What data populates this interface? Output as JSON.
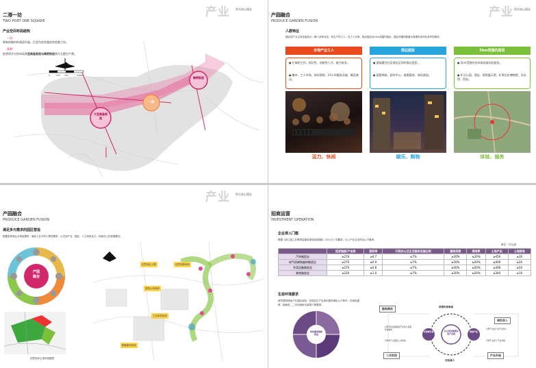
{
  "header_brand": "产业",
  "header_sub": "四大核心理念",
  "p1": {
    "title": "二港一坊",
    "title_en": "TWO PORT ONE SQUARE",
    "section": "产业空间布局结构",
    "item1_head": "一坊：",
    "item1_text": "原有的棚村的改造升级，打造为综合服务的首要工坊。",
    "item2_head": "两港：",
    "item2_text_a": "依然同步分别布局",
    "item2_text_b": "大型装备制造与精密制造",
    "item2_text_c": "两大主题生产港。",
    "scale_0": "0",
    "scale_250": "250",
    "scale_500": "500",
    "scale_1000": "1000m",
    "node_big": "大型装备制造",
    "node_fang": "一坊",
    "node_precise": "精密制造"
  },
  "p2": {
    "title": "产园融合",
    "title_en": "PRODUCE GARDEN FUSION",
    "section": "人群特征",
    "intro": "园区将产业主体总量较大，覆人多种业态，有生产的工人，在工人日常、周边居民及5km范围内居民，园区完善的配套为其提供多样化多环的服务。",
    "cards": [
      {
        "head": "本地产业工人",
        "color": "#e8491d",
        "b1": "忙碌的工作，知识性、创新性人才，能力有关。",
        "b2": "集市、工人市场、休闲酒吧、24小时服务设施、精品商店。",
        "caption": "活力、休闲"
      },
      {
        "head": "周边居民",
        "color": "#27a4dc",
        "b1": "基础看往社区就近买到的周边居民。",
        "b2": "配套商街、超市中心、度假基地、休闲游园。",
        "caption": "娱乐、购物"
      },
      {
        "head": "5km范围内居民",
        "color": "#7bbf3a",
        "b1": "5km范围内对本休闲游玩的居民。",
        "b2": "旷达公园、酒店、规划展示馆、矿泉历史博物馆、文化馆、民俗。",
        "caption": "体验、服务"
      }
    ]
  },
  "p3": {
    "title": "产园融合",
    "title_en": "PRODUCE GARDEN FUSION",
    "section": "满足多元需求的园区营造",
    "intro": "配置多样商业业场及需求，满足工业不同人群的需求，以达到产业、园区、人之间有活力，持续向上的发展模式。",
    "ring_center_a": "产园",
    "ring_center_b": "融合",
    "map_caption": "创意地块土地利用图表",
    "label_a": "创意商业人群",
    "label_b": "创意创新地块",
    "label_c": "提质公司地块",
    "label_d": "工业研发地块",
    "label_e": "配套服务地块"
  },
  "p4": {
    "title": "招商运营",
    "title_en": "INVESTMENT OPERATION",
    "section1": "企业准入门槛",
    "intro": "根据《浙江省工业等项目建设用地控制指标（2014）》的要求，引入产业应当符合以下要求。",
    "unit": "单位：万元/亩",
    "headers": [
      "",
      "投资强度/产出效",
      "容积率",
      "行政办公及生活服务设施比例",
      "建筑系数",
      "绿地率",
      "土地产出",
      "土地税收"
    ],
    "rows": [
      [
        "汽车制造业",
        "≥270",
        "≥0.7",
        "≤7%",
        "≥30%",
        "≤20%",
        "≥450",
        "≥30"
      ],
      [
        "电气机械和器材制造业",
        "≥270",
        "≥0.9",
        "≤7%",
        "≥30%",
        "≤20%",
        "≥400",
        "≥20"
      ],
      [
        "专用设备制造业",
        "≥270",
        "≥0.8",
        "≤7%",
        "≥30%",
        "≤20%",
        "≥300",
        "≥20"
      ],
      [
        "其他制造业",
        "≥220",
        "≥1.0",
        "≤7%",
        "≥30%",
        "≤20%",
        "≥340",
        "≥10"
      ]
    ],
    "section2": "生态环境要求",
    "eco_text": "研究周构绿色产业园区经验，在相应生产区域可要求满足以下条件：在绿色建筑、能耗低、二次利用和污染物少等要求。",
    "wheel_center": "绿色建筑智能制造",
    "cycle_top": "资源利用率高",
    "cycle_center_a": "长兴绿色智能制造产业园",
    "cycle_left": "可持续开发",
    "cycle_right": "绿色产业",
    "cycle_bottom": "污染减小",
    "box_tl": "能耗降低",
    "box_tr": "绿色导入",
    "box_bl": "二次利用",
    "box_br": "产业升级",
    "tl_note": "引导可持续发展的产业导入能源利用效率",
    "tr_note": "引导产业各个新产业导入",
    "bl_note": "引导引产业能源二次利用",
    "br_note": "引导产业各个产业升级"
  }
}
